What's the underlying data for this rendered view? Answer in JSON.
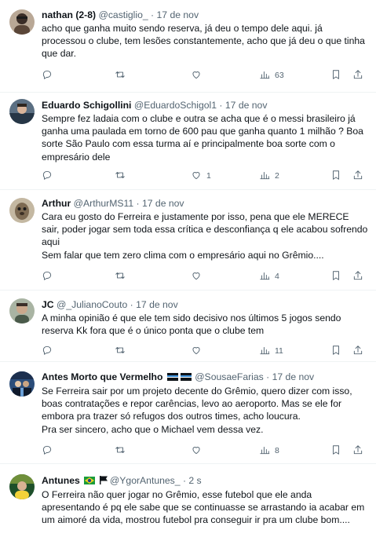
{
  "tweets": [
    {
      "name": "nathan (2-8)",
      "handle": "@castiglio_",
      "dot": "·",
      "time": "17 de nov",
      "lines": [
        "acho que ganha muito sendo reserva, já deu o tempo dele aqui. já processou o clube, tem lesões constantemente, acho que já deu o que tinha que dar."
      ],
      "stats": {
        "replies": "",
        "retweets": "",
        "likes": "",
        "views": "63"
      }
    },
    {
      "name": "Eduardo Schigollini",
      "handle": "@EduardoSchigol1",
      "dot": "·",
      "time": "17 de nov",
      "lines": [
        "Sempre fez ladaia com o clube e outra se acha que é o messi brasileiro já ganha uma paulada em torno de 600 pau que ganha quanto 1 milhão ? Boa sorte São Paulo com essa turma aí e principalmente boa sorte com o empresário dele"
      ],
      "stats": {
        "replies": "",
        "retweets": "",
        "likes": "1",
        "views": "2"
      }
    },
    {
      "name": "Arthur",
      "handle": "@ArthurMS11",
      "dot": "·",
      "time": "17 de nov",
      "lines": [
        "Cara eu gosto do Ferreira e justamente por isso, pena que ele MERECE sair, poder jogar sem toda essa crítica e desconfiança q ele acabou sofrendo aqui",
        "Sem falar que tem zero clima com o empresário aqui no Grêmio...."
      ],
      "stats": {
        "replies": "",
        "retweets": "",
        "likes": "",
        "views": "4"
      }
    },
    {
      "name": "JC",
      "handle": "@_JulianoCouto",
      "dot": "·",
      "time": "17 de nov",
      "lines": [
        "A minha opinião é que ele tem sido decisivo nos últimos 5 jogos sendo reserva Kk fora que é o único ponta que o clube tem"
      ],
      "stats": {
        "replies": "",
        "retweets": "",
        "likes": "",
        "views": "11"
      }
    },
    {
      "name": "Antes Morto que Vermelho",
      "handle": "@SousaeFarias",
      "dot": "·",
      "time": "17 de nov",
      "lines": [
        "Se Ferreira sair por um projeto decente do Grêmio, quero dizer com isso, boas contratações e repor carências, levo ao aeroporto. Mas se ele for embora pra trazer só refugos dos outros times, acho loucura.",
        "Pra ser sincero, acho que o Michael vem dessa vez."
      ],
      "stats": {
        "replies": "",
        "retweets": "",
        "likes": "",
        "views": "8"
      }
    },
    {
      "name": "Antunes",
      "handle": "@YgorAntunes_",
      "dot": "·",
      "time": "2 s",
      "lines": [
        "O Ferreira não quer jogar no Grêmio, esse futebol que ele anda apresentando é pq ele sabe que se continuasse se arrastando ia acabar em um aimoré da vida, mostrou futebol pra conseguir ir pra um clube bom...."
      ],
      "stats": {
        "replies": "",
        "retweets": "",
        "likes": "",
        "views": ""
      }
    }
  ],
  "icons": {
    "reply": "reply-icon",
    "retweet": "retweet-icon",
    "like": "like-icon",
    "views": "views-icon",
    "bookmark": "bookmark-icon",
    "share": "share-icon"
  },
  "colors": {
    "text": "#0f1419",
    "muted": "#536471",
    "divider": "#eff3f4",
    "background": "#ffffff"
  }
}
